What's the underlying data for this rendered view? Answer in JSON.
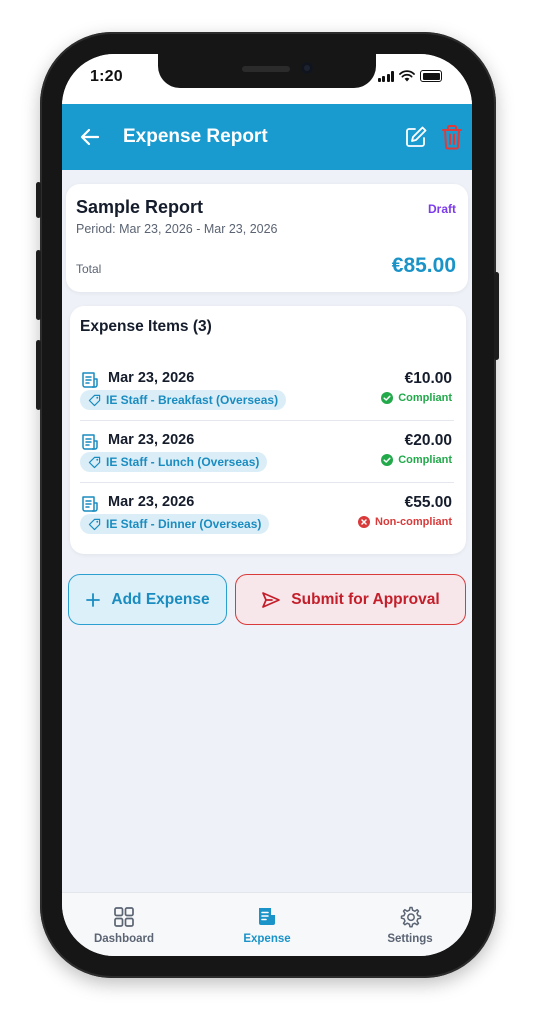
{
  "status_bar": {
    "time": "1:20"
  },
  "header": {
    "title": "Expense Report"
  },
  "report": {
    "name": "Sample Report",
    "status": "Draft",
    "period": "Period: Mar 23, 2026 - Mar 23, 2026",
    "total_label": "Total",
    "total": "€85.00"
  },
  "items_section": {
    "title": "Expense Items (3)",
    "items": [
      {
        "date": "Mar 23, 2026",
        "category": "IE Staff - Breakfast (Overseas)",
        "amount": "€10.00",
        "status": "Compliant"
      },
      {
        "date": "Mar 23, 2026",
        "category": "IE Staff - Lunch (Overseas)",
        "amount": "€20.00",
        "status": "Compliant"
      },
      {
        "date": "Mar 23, 2026",
        "category": "IE Staff - Dinner (Overseas)",
        "amount": "€55.00",
        "status": "Non-compliant"
      }
    ]
  },
  "actions": {
    "add_label": "Add Expense",
    "submit_label": "Submit for Approval"
  },
  "bottom_nav": {
    "items": [
      {
        "label": "Dashboard",
        "icon": "dashboard-grid-icon"
      },
      {
        "label": "Expense",
        "icon": "expense-receipt-icon",
        "active": true
      },
      {
        "label": "Settings",
        "icon": "gear-icon"
      }
    ]
  },
  "colors": {
    "primary": "#1a9bd0",
    "draft": "#7c3aed",
    "compliant": "#22a94a",
    "non_compliant": "#d93a3a",
    "delete": "#e03a3a"
  }
}
